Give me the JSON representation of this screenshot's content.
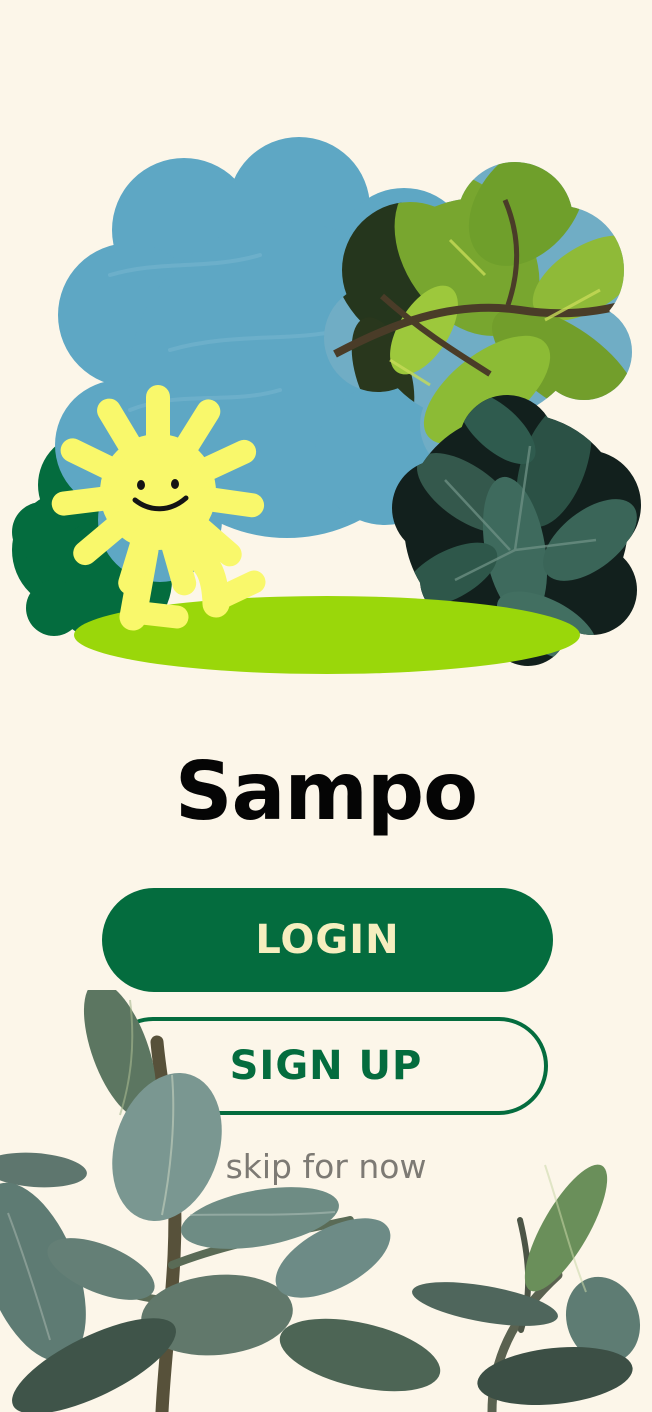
{
  "app": {
    "title": "Sampo"
  },
  "actions": {
    "login_label": "LOGIN",
    "signup_label": "SIGN UP",
    "skip_label": "skip for now"
  },
  "colors": {
    "background": "#fcf6e9",
    "primary_green": "#046c3e",
    "login_text": "#f6eebf",
    "sky_blue": "#5ea7c4",
    "sun_yellow": "#f9f86b",
    "grass_green": "#9ad70a",
    "bush_green": "#046c3e"
  },
  "illustration": {
    "icons": [
      "sun-mascot-icon",
      "cloud-icon",
      "leaf-photo-icon",
      "bush-icon",
      "grass-icon",
      "plant-photo-icon"
    ]
  }
}
